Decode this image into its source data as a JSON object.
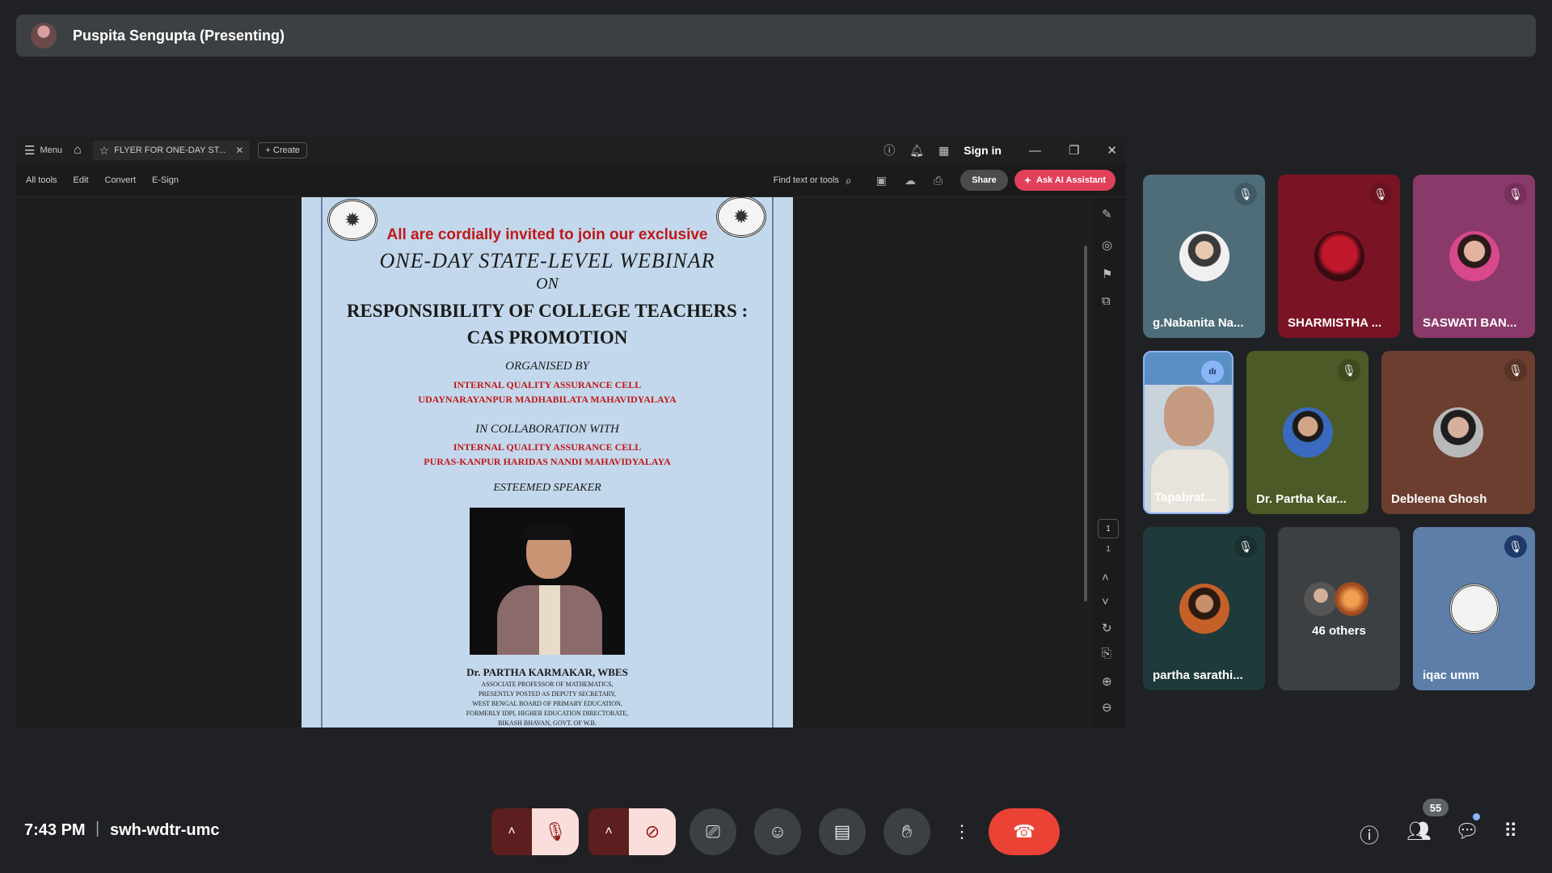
{
  "presenter": {
    "name": "Puspita Sengupta (Presenting)"
  },
  "acrobat": {
    "menu_label": "Menu",
    "tab_title": "FLYER FOR ONE-DAY ST...",
    "create_label": "Create",
    "sign_in": "Sign in",
    "toolbar": [
      "All tools",
      "Edit",
      "Convert",
      "E-Sign"
    ],
    "find_placeholder": "Find text or tools",
    "share_label": "Share",
    "ai_label": "Ask AI Assistant",
    "page_current": "1",
    "page_total": "1"
  },
  "flyer": {
    "invite": "All are cordially invited to join our exclusive",
    "webinar": "ONE-DAY STATE-LEVEL WEBINAR",
    "on": "ON",
    "topic_line1": "RESPONSIBILITY OF COLLEGE TEACHERS :",
    "topic_line2": "CAS PROMOTION",
    "organised_by": "ORGANISED BY",
    "org_line1": "INTERNAL QUALITY ASSURANCE CELL",
    "org_line2": "UDAYNARAYANPUR MADHABILATA MAHAVIDYALAYA",
    "collab": "IN COLLABORATION WITH",
    "collab_line1": "INTERNAL QUALITY ASSURANCE CELL",
    "collab_line2": "PURAS-KANPUR HARIDAS NANDI MAHAVIDYALAYA",
    "speaker_heading": "ESTEEMED SPEAKER",
    "speaker_name": "Dr. PARTHA KARMAKAR, WBES",
    "speaker_lines": [
      "ASSOCIATE PROFESSOR OF MATHEMATICS,",
      "PRESENTLY POSTED AS DEPUTY SECRETARY,",
      "WEST BENGAL BOARD OF PRIMARY EDUCATION,",
      "FORMERLY IDPI, HIGHER EDUCATION DIRECTORATE,",
      "BIKASH BHAVAN, GOVT. OF W.B."
    ]
  },
  "participants": [
    {
      "name": "g.Nabanita Na...",
      "state": "muted"
    },
    {
      "name": "SHARMISTHA ...",
      "state": "muted"
    },
    {
      "name": "SASWATI BAN...",
      "state": "muted"
    },
    {
      "name": "Tapabrat...",
      "state": "speaking"
    },
    {
      "name": "Dr. Partha Kar...",
      "state": "muted"
    },
    {
      "name": "Debleena Ghosh",
      "state": "muted"
    },
    {
      "name": "partha sarathi...",
      "state": "muted"
    },
    {
      "name": "46 others",
      "state": "group"
    },
    {
      "name": "iqac umm",
      "state": "muted"
    }
  ],
  "footer": {
    "time": "7:43 PM",
    "separator": "|",
    "meeting_code": "swh-wdtr-umc",
    "people_count": "55"
  },
  "colors": {
    "end_call": "#ea4335",
    "mic_off_bg": "#f9dedc",
    "speaking": "#8ab4f8"
  }
}
